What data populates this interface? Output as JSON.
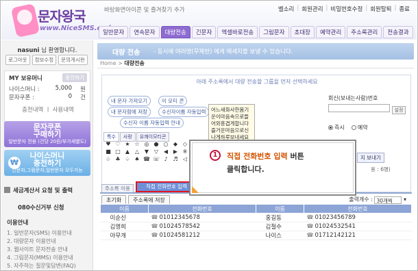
{
  "header": {
    "logo_text": "문자왕국",
    "logo_sub": "www.NiceSMS.co.kr",
    "bookmark": "바탕화면아이콘 및 즐겨찾기 추가",
    "toplinks": [
      "벨소리",
      "회원관리",
      "비밀번호수정",
      "회원탈퇴",
      "종료"
    ],
    "nav": [
      "일반문자",
      "연속문자",
      "대량전송",
      "긴문자",
      "엑셀바로전송",
      "그림문자",
      "초대장",
      "예약관리",
      "주소록관리",
      "전송결과"
    ],
    "active_nav": "대량전송"
  },
  "sidebar": {
    "welcome_user": "nasuni",
    "welcome_suffix": "님 환영합니다.",
    "buttons": [
      "로그아웃",
      "정보수정",
      "문의게시판"
    ],
    "money_title": "MY 보유머니",
    "charge_label": "충전하기",
    "nice_money_label": "나이스머니 :",
    "nice_money_value": "5,000",
    "nice_money_unit": "원",
    "coupon_label": "문자쿠폰 :",
    "coupon_value": "0",
    "coupon_unit": "건",
    "history_links": "충전내역 ㅣ 사용내역",
    "promo1": {
      "title": "문자쿠폰",
      "subtitle": "구매하기",
      "note": "일반문자 전용 (건당 20원/부가세별도)"
    },
    "promo2": {
      "title": "나이스머니",
      "subtitle": "충전하기",
      "note": "긴문자,그림문자,일반문자 모두가능"
    },
    "tax_menu": "세금계산서 요청 및 출력",
    "number_menu": "080수신거부 신청",
    "guide_title": "이용안내",
    "guide_items": [
      "1. 일반문자(SMS) 이용안내",
      "2. 대량문자 이용안내",
      "3. 웹사이트 문자전송 안내",
      "4. 그림문자(MMS) 이용안내",
      "5. 자주하는 질문및답변(FAQ)"
    ]
  },
  "main": {
    "banner_title": "대량 전송",
    "banner_desc": "- 동시에 여러명(무제한) 에게 메세지를 보낼 수 있습니다.",
    "breadcrumb_home": "Home >",
    "breadcrumb_current": "대량전송",
    "addr_instruction": "아래 주소록에서 대량 전송할 그룹을 먼저 선택하세요",
    "pill_buttons": [
      "내 문자 가져오기",
      "이 모티 콘",
      "내 문자함에 저장",
      "수신자이름 자동입력",
      "수신자 이름 자동입력 안내"
    ],
    "emoji_tabs": [
      "특수",
      "사랑",
      "유쾌이모티콘"
    ],
    "emoji_chars": [
      "♥",
      "♡",
      "★",
      "☆",
      "◎",
      "●",
      "○",
      "◆",
      "◇",
      "■",
      "□",
      "▲",
      "△",
      "▼",
      "▽",
      "◀",
      "▶",
      "※",
      "♧",
      "♣",
      "♤",
      "♠",
      "☎",
      "☏",
      "♪",
      "♬",
      "◁"
    ],
    "preview_text": "어느새화사한봄기운이마음속으로들어와흥겹게합니다 즐거운마음으로신나게하루보내세요",
    "callback_label": "회신(보내는사람)번호",
    "callback_btn": "설정",
    "immediate_label": "즉시",
    "reserve_label": "예약",
    "send_label": "지 보내기",
    "send_info": "용 : 6명)"
  },
  "callout": {
    "number": "1",
    "highlight": "직접 전화번호 입력",
    "after": "버튼",
    "line2": "클릭합니다."
  },
  "bottom": {
    "tab_addressbook": "주소록 이용",
    "tab_direct": "직접 전화번호 입력",
    "btn_reset": "초기화",
    "btn_save": "주소록에 저장",
    "output_label": "출력개수 :",
    "output_value": "30개씩",
    "columns": [
      "이름",
      "전화번호",
      "이름",
      "전화번호"
    ],
    "rows": [
      {
        "n1": "이순신",
        "p1": "01012345678",
        "n2": "홍길동",
        "p2": "01023456789"
      },
      {
        "n1": "김영희",
        "p1": "01024578542",
        "n2": "김철수",
        "p2": "01024532541"
      },
      {
        "n1": "아무개",
        "p1": "01024581212",
        "n2": "나이스",
        "p2": "01712142121"
      }
    ]
  }
}
